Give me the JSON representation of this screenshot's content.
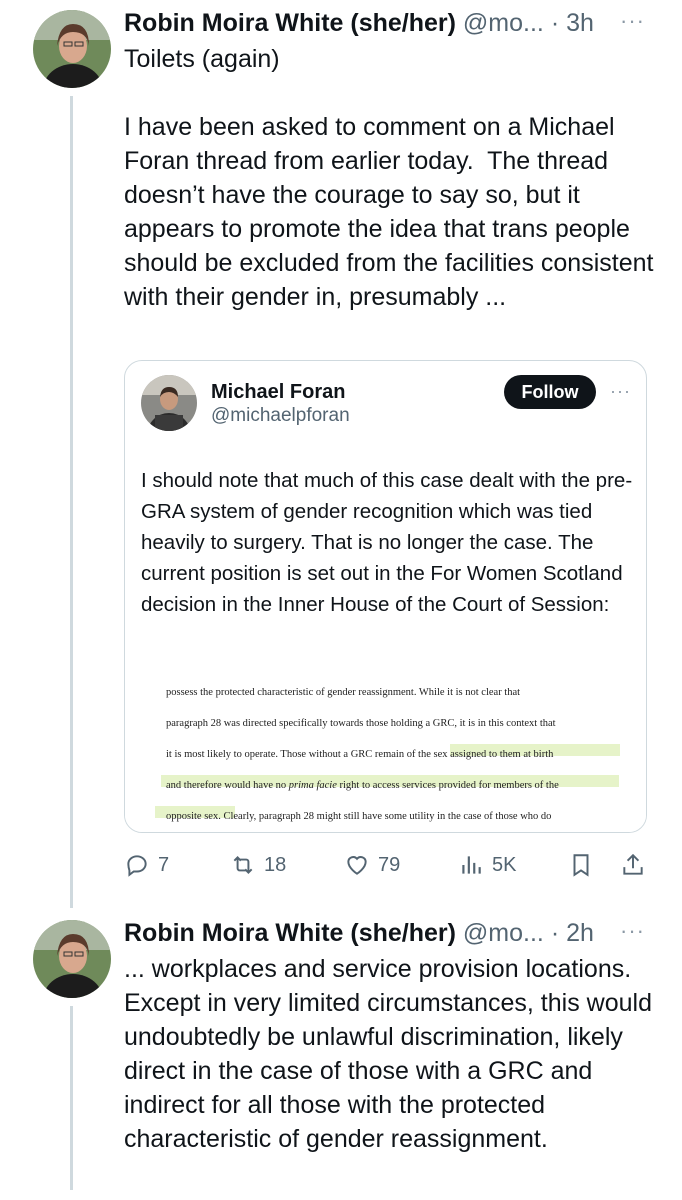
{
  "posts": [
    {
      "author_name": "Robin Moira White (she/her)",
      "handle": "@mo...",
      "time": "· 3h",
      "text": "Toilets (again)\n\nI have been asked to comment on a Michael Foran thread from earlier today.  The thread doesn’t have the courage to say so, but it appears to promote the idea that trans people should be excluded from the facilities consistent with their gender in, presumably ...",
      "more": "···"
    },
    {
      "author_name": "Robin Moira White (she/her)",
      "handle": "@mo...",
      "time": "· 2h",
      "text": "... workplaces and service provision locations.  Except in very limited circumstances, this would undoubtedly be unlawful discrimination, likely direct in the case of those with a GRC and indirect for all those with the protected characteristic of gender reassignment.",
      "more": "···"
    }
  ],
  "quote": {
    "author_name": "Michael Foran",
    "handle": "@michaelpforan",
    "follow_label": "Follow",
    "more": "···",
    "text": "I should note that much of this case dealt with the pre-GRA system of gender recognition which was tied heavily to surgery. That is no longer the case. The current position is set out in the For Women Scotland decision in the Inner House of the Court of Session:",
    "document_lines": [
      "possess the protected characteristic of gender reassignment.  While it is not clear that",
      "paragraph 28 was directed specifically towards those holding a GRC, it is in this context that",
      "it is most likely to operate.  Those without a GRC remain of the sex assigned to them at birth",
      "and therefore would have no prima facie right to access services provided for members of the",
      "opposite sex.  Clearly, paragraph 28 might still have some utility in the case of those who do"
    ]
  },
  "actions": {
    "replies": "7",
    "reposts": "18",
    "likes": "79",
    "views": "5K"
  },
  "icons": {
    "reply": "reply-icon",
    "repost": "repost-icon",
    "like": "heart-icon",
    "views": "views-icon",
    "bookmark": "bookmark-icon",
    "share": "share-icon"
  }
}
